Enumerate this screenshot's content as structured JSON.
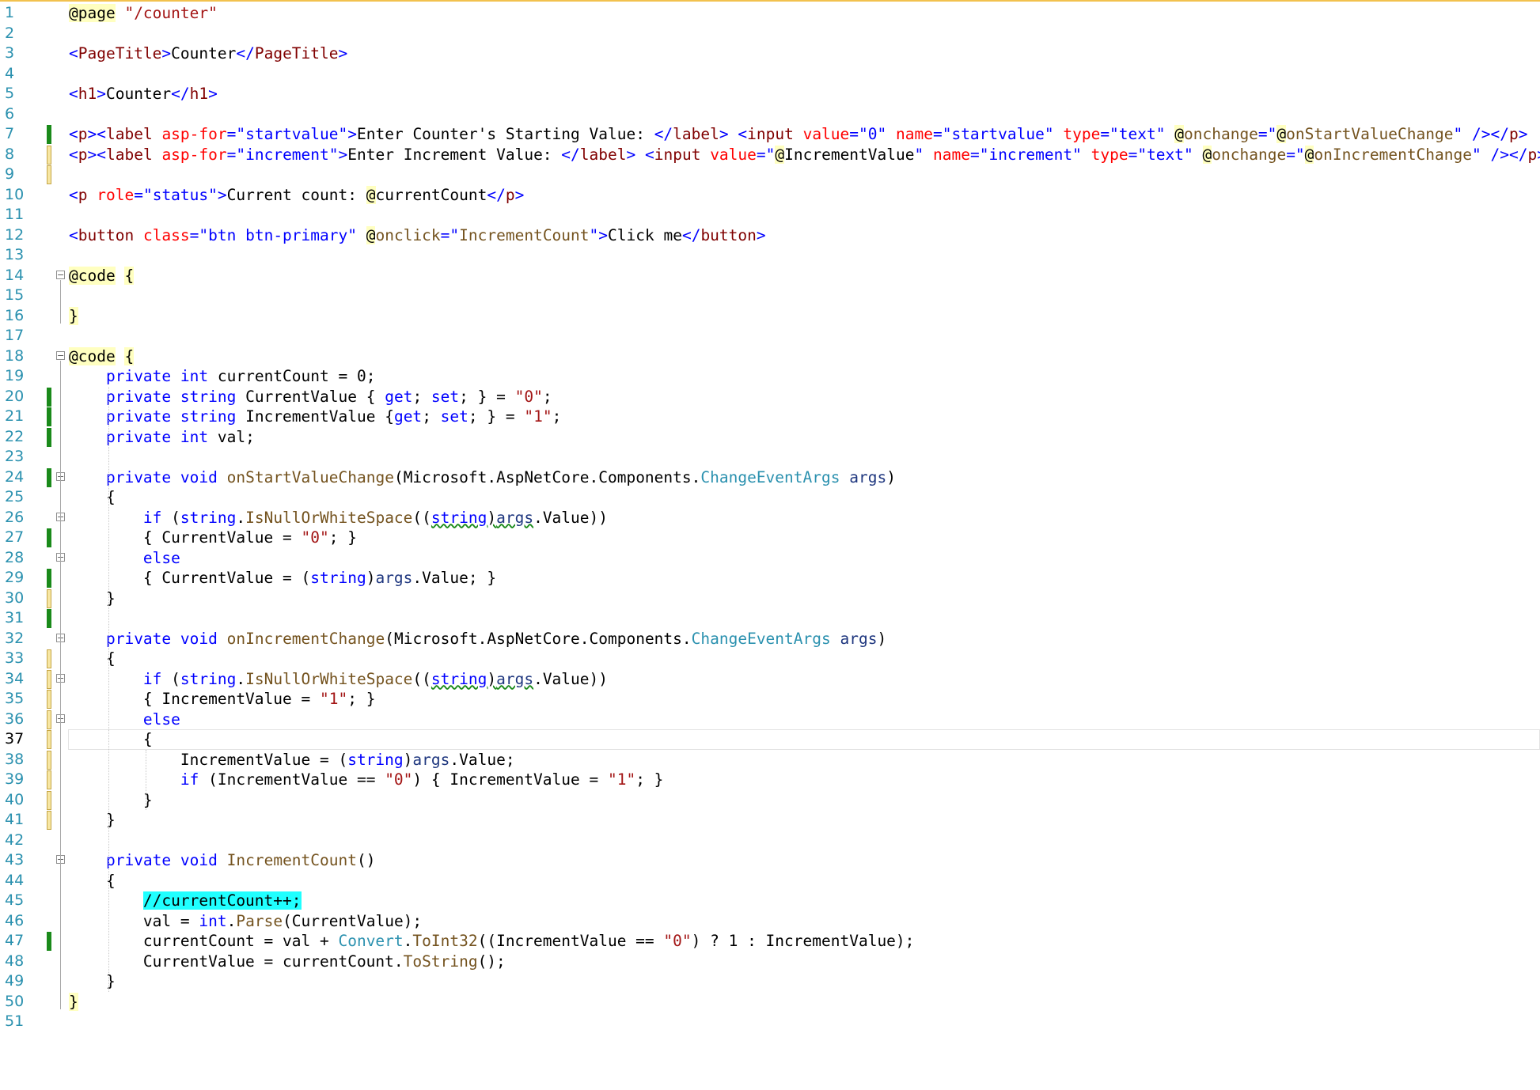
{
  "editor": {
    "active_line": 37,
    "line_numbers": [
      "1",
      "2",
      "3",
      "4",
      "5",
      "6",
      "7",
      "8",
      "9",
      "10",
      "11",
      "12",
      "13",
      "14",
      "15",
      "16",
      "17",
      "18",
      "19",
      "20",
      "21",
      "22",
      "23",
      "24",
      "25",
      "26",
      "27",
      "28",
      "29",
      "30",
      "31",
      "32",
      "33",
      "34",
      "35",
      "36",
      "37",
      "38",
      "39",
      "40",
      "41",
      "42",
      "43",
      "44",
      "45",
      "46",
      "47",
      "48",
      "49",
      "50",
      "51"
    ],
    "lines": [
      [
        [
          "@page",
          "razor"
        ],
        [
          " "
        ],
        [
          "\"/counter\"",
          "cs"
        ]
      ],
      [],
      [
        [
          "<",
          "str"
        ],
        [
          "PageTitle",
          "tag"
        ],
        [
          ">",
          "str"
        ],
        [
          "Counter"
        ],
        [
          "</",
          "str"
        ],
        [
          "PageTitle",
          "tag"
        ],
        [
          ">",
          "str"
        ]
      ],
      [],
      [
        [
          "<",
          "str"
        ],
        [
          "h1",
          "tag"
        ],
        [
          ">",
          "str"
        ],
        [
          "Counter"
        ],
        [
          "</",
          "str"
        ],
        [
          "h1",
          "tag"
        ],
        [
          ">",
          "str"
        ]
      ],
      [],
      [
        [
          "<",
          "str"
        ],
        [
          "p",
          "tag"
        ],
        [
          "><",
          "str"
        ],
        [
          "label",
          "tag"
        ],
        [
          " "
        ],
        [
          "asp-for",
          "attr"
        ],
        [
          "=\"startvalue\"",
          "str"
        ],
        [
          ">",
          "str"
        ],
        [
          "Enter Counter's Starting Value: "
        ],
        [
          "</",
          "str"
        ],
        [
          "label",
          "tag"
        ],
        [
          ">",
          "str"
        ],
        [
          " "
        ],
        [
          "<",
          "str"
        ],
        [
          "input",
          "tag"
        ],
        [
          " "
        ],
        [
          "value",
          "attr"
        ],
        [
          "=\"0\"",
          "str"
        ],
        [
          " "
        ],
        [
          "name",
          "attr"
        ],
        [
          "=\"startvalue\"",
          "str"
        ],
        [
          " "
        ],
        [
          "type",
          "attr"
        ],
        [
          "=\"text\"",
          "str"
        ],
        [
          " "
        ],
        [
          "@",
          "razor"
        ],
        [
          "onchange",
          "fn"
        ],
        [
          "=\"",
          "str"
        ],
        [
          "@",
          "razor"
        ],
        [
          "onStartValueChange",
          "fn"
        ],
        [
          "\"",
          "str"
        ],
        [
          " />",
          "str"
        ],
        [
          "</",
          "str"
        ],
        [
          "p",
          "tag"
        ],
        [
          ">",
          "str"
        ]
      ],
      [
        [
          "<",
          "str"
        ],
        [
          "p",
          "tag"
        ],
        [
          "><",
          "str"
        ],
        [
          "label",
          "tag"
        ],
        [
          " "
        ],
        [
          "asp-for",
          "attr"
        ],
        [
          "=\"increment\"",
          "str"
        ],
        [
          ">",
          "str"
        ],
        [
          "Enter Increment Value: "
        ],
        [
          "</",
          "str"
        ],
        [
          "label",
          "tag"
        ],
        [
          ">",
          "str"
        ],
        [
          " "
        ],
        [
          "<",
          "str"
        ],
        [
          "input",
          "tag"
        ],
        [
          " "
        ],
        [
          "value",
          "attr"
        ],
        [
          "=\"",
          "str"
        ],
        [
          "@",
          "razor"
        ],
        [
          "IncrementValue"
        ],
        [
          "\"",
          "str"
        ],
        [
          " "
        ],
        [
          "name",
          "attr"
        ],
        [
          "=\"increment\"",
          "str"
        ],
        [
          " "
        ],
        [
          "type",
          "attr"
        ],
        [
          "=\"text\"",
          "str"
        ],
        [
          " "
        ],
        [
          "@",
          "razor"
        ],
        [
          "onchange",
          "fn"
        ],
        [
          "=\"",
          "str"
        ],
        [
          "@",
          "razor"
        ],
        [
          "onIncrementChange",
          "fn"
        ],
        [
          "\"",
          "str"
        ],
        [
          " />",
          "str"
        ],
        [
          "</",
          "str"
        ],
        [
          "p",
          "tag"
        ],
        [
          ">",
          "str"
        ]
      ],
      [],
      [
        [
          "<",
          "str"
        ],
        [
          "p",
          "tag"
        ],
        [
          " "
        ],
        [
          "role",
          "attr"
        ],
        [
          "=\"status\"",
          "str"
        ],
        [
          ">",
          "str"
        ],
        [
          "Current count: "
        ],
        [
          "@",
          "razor"
        ],
        [
          "currentCount"
        ],
        [
          "</",
          "str"
        ],
        [
          "p",
          "tag"
        ],
        [
          ">",
          "str"
        ]
      ],
      [],
      [
        [
          "<",
          "str"
        ],
        [
          "button",
          "tag"
        ],
        [
          " "
        ],
        [
          "class",
          "attr"
        ],
        [
          "=\"btn btn-primary\"",
          "str"
        ],
        [
          " "
        ],
        [
          "@",
          "razor"
        ],
        [
          "onclick",
          "fn"
        ],
        [
          "=\"",
          "str"
        ],
        [
          "IncrementCount",
          "fn"
        ],
        [
          "\"",
          "str"
        ],
        [
          ">",
          "str"
        ],
        [
          "Click me"
        ],
        [
          "</",
          "str"
        ],
        [
          "button",
          "tag"
        ],
        [
          ">",
          "str"
        ]
      ],
      [],
      [
        [
          "@code",
          "razor"
        ],
        [
          " "
        ],
        [
          "{",
          "razor"
        ]
      ],
      [],
      [
        [
          "}",
          "razor"
        ]
      ],
      [],
      [
        [
          "@code",
          "razor"
        ],
        [
          " "
        ],
        [
          "{",
          "razor"
        ]
      ],
      [
        [
          "    "
        ],
        [
          "private",
          "kw"
        ],
        [
          " "
        ],
        [
          "int",
          "kw"
        ],
        [
          " currentCount = 0;"
        ]
      ],
      [
        [
          "    "
        ],
        [
          "private",
          "kw"
        ],
        [
          " "
        ],
        [
          "string",
          "kw"
        ],
        [
          " CurrentValue { "
        ],
        [
          "get",
          "kw"
        ],
        [
          "; "
        ],
        [
          "set",
          "kw"
        ],
        [
          "; } = "
        ],
        [
          "\"0\"",
          "cs"
        ],
        [
          ";"
        ]
      ],
      [
        [
          "    "
        ],
        [
          "private",
          "kw"
        ],
        [
          " "
        ],
        [
          "string",
          "kw"
        ],
        [
          " IncrementValue {"
        ],
        [
          "get",
          "kw"
        ],
        [
          "; "
        ],
        [
          "set",
          "kw"
        ],
        [
          "; } = "
        ],
        [
          "\"1\"",
          "cs"
        ],
        [
          ";"
        ]
      ],
      [
        [
          "    "
        ],
        [
          "private",
          "kw"
        ],
        [
          " "
        ],
        [
          "int",
          "kw"
        ],
        [
          " val;"
        ]
      ],
      [],
      [
        [
          "    "
        ],
        [
          "private",
          "kw"
        ],
        [
          " "
        ],
        [
          "void",
          "kw"
        ],
        [
          " "
        ],
        [
          "onStartValueChange",
          "fn"
        ],
        [
          "(Microsoft.AspNetCore.Components."
        ],
        [
          "ChangeEventArgs",
          "type"
        ],
        [
          " "
        ],
        [
          "args",
          "var"
        ],
        [
          ")"
        ]
      ],
      [
        [
          "    {"
        ]
      ],
      [
        [
          "        "
        ],
        [
          "if",
          "kw"
        ],
        [
          " ("
        ],
        [
          "string",
          "kw"
        ],
        [
          "."
        ],
        [
          "IsNullOrWhiteSpace",
          "fn"
        ],
        [
          "(("
        ],
        [
          "string",
          "kw"
        ],
        [
          ")"
        ],
        [
          "args",
          "var"
        ],
        [
          ".Value))"
        ]
      ],
      [
        [
          "        { CurrentValue = "
        ],
        [
          "\"0\"",
          "cs"
        ],
        [
          "; }"
        ]
      ],
      [
        [
          "        "
        ],
        [
          "else",
          "kw"
        ]
      ],
      [
        [
          "        { CurrentValue = ("
        ],
        [
          "string",
          "kw"
        ],
        [
          ")"
        ],
        [
          "args",
          "var"
        ],
        [
          ".Value; }"
        ]
      ],
      [
        [
          "    }"
        ]
      ],
      [],
      [
        [
          "    "
        ],
        [
          "private",
          "kw"
        ],
        [
          " "
        ],
        [
          "void",
          "kw"
        ],
        [
          " "
        ],
        [
          "onIncrementChange",
          "fn"
        ],
        [
          "(Microsoft.AspNetCore.Components."
        ],
        [
          "ChangeEventArgs",
          "type"
        ],
        [
          " "
        ],
        [
          "args",
          "var"
        ],
        [
          ")"
        ]
      ],
      [
        [
          "    {"
        ]
      ],
      [
        [
          "        "
        ],
        [
          "if",
          "kw"
        ],
        [
          " ("
        ],
        [
          "string",
          "kw"
        ],
        [
          "."
        ],
        [
          "IsNullOrWhiteSpace",
          "fn"
        ],
        [
          "(("
        ],
        [
          "string",
          "kw"
        ],
        [
          ")"
        ],
        [
          "args",
          "var"
        ],
        [
          ".Value))"
        ]
      ],
      [
        [
          "        { IncrementValue = "
        ],
        [
          "\"1\"",
          "cs"
        ],
        [
          "; }"
        ]
      ],
      [
        [
          "        "
        ],
        [
          "else",
          "kw"
        ]
      ],
      [
        [
          "        {"
        ]
      ],
      [
        [
          "            IncrementValue = ("
        ],
        [
          "string",
          "kw"
        ],
        [
          ")"
        ],
        [
          "args",
          "var"
        ],
        [
          ".Value;"
        ]
      ],
      [
        [
          "            "
        ],
        [
          "if",
          "kw"
        ],
        [
          " (IncrementValue == "
        ],
        [
          "\"0\"",
          "cs"
        ],
        [
          ") { IncrementValue = "
        ],
        [
          "\"1\"",
          "cs"
        ],
        [
          "; }"
        ]
      ],
      [
        [
          "        }"
        ]
      ],
      [
        [
          "    }"
        ]
      ],
      [],
      [
        [
          "    "
        ],
        [
          "private",
          "kw"
        ],
        [
          " "
        ],
        [
          "void",
          "kw"
        ],
        [
          " "
        ],
        [
          "IncrementCount",
          "fn"
        ],
        [
          "()"
        ]
      ],
      [
        [
          "    {"
        ]
      ],
      [
        [
          "        "
        ],
        [
          "//currentCount++;",
          "cmt"
        ]
      ],
      [
        [
          "        val = "
        ],
        [
          "int",
          "kw"
        ],
        [
          "."
        ],
        [
          "Parse",
          "fn"
        ],
        [
          "(CurrentValue);"
        ]
      ],
      [
        [
          "        currentCount = val + "
        ],
        [
          "Convert",
          "type"
        ],
        [
          "."
        ],
        [
          "ToInt32",
          "fn"
        ],
        [
          "((IncrementValue == "
        ],
        [
          "\"0\"",
          "cs"
        ],
        [
          ") ? 1 : IncrementValue);"
        ]
      ],
      [
        [
          "        CurrentValue = currentCount."
        ],
        [
          "ToString",
          "fn"
        ],
        [
          "();"
        ]
      ],
      [
        [
          "    }"
        ]
      ],
      [
        [
          "}",
          "razor"
        ]
      ],
      []
    ]
  }
}
